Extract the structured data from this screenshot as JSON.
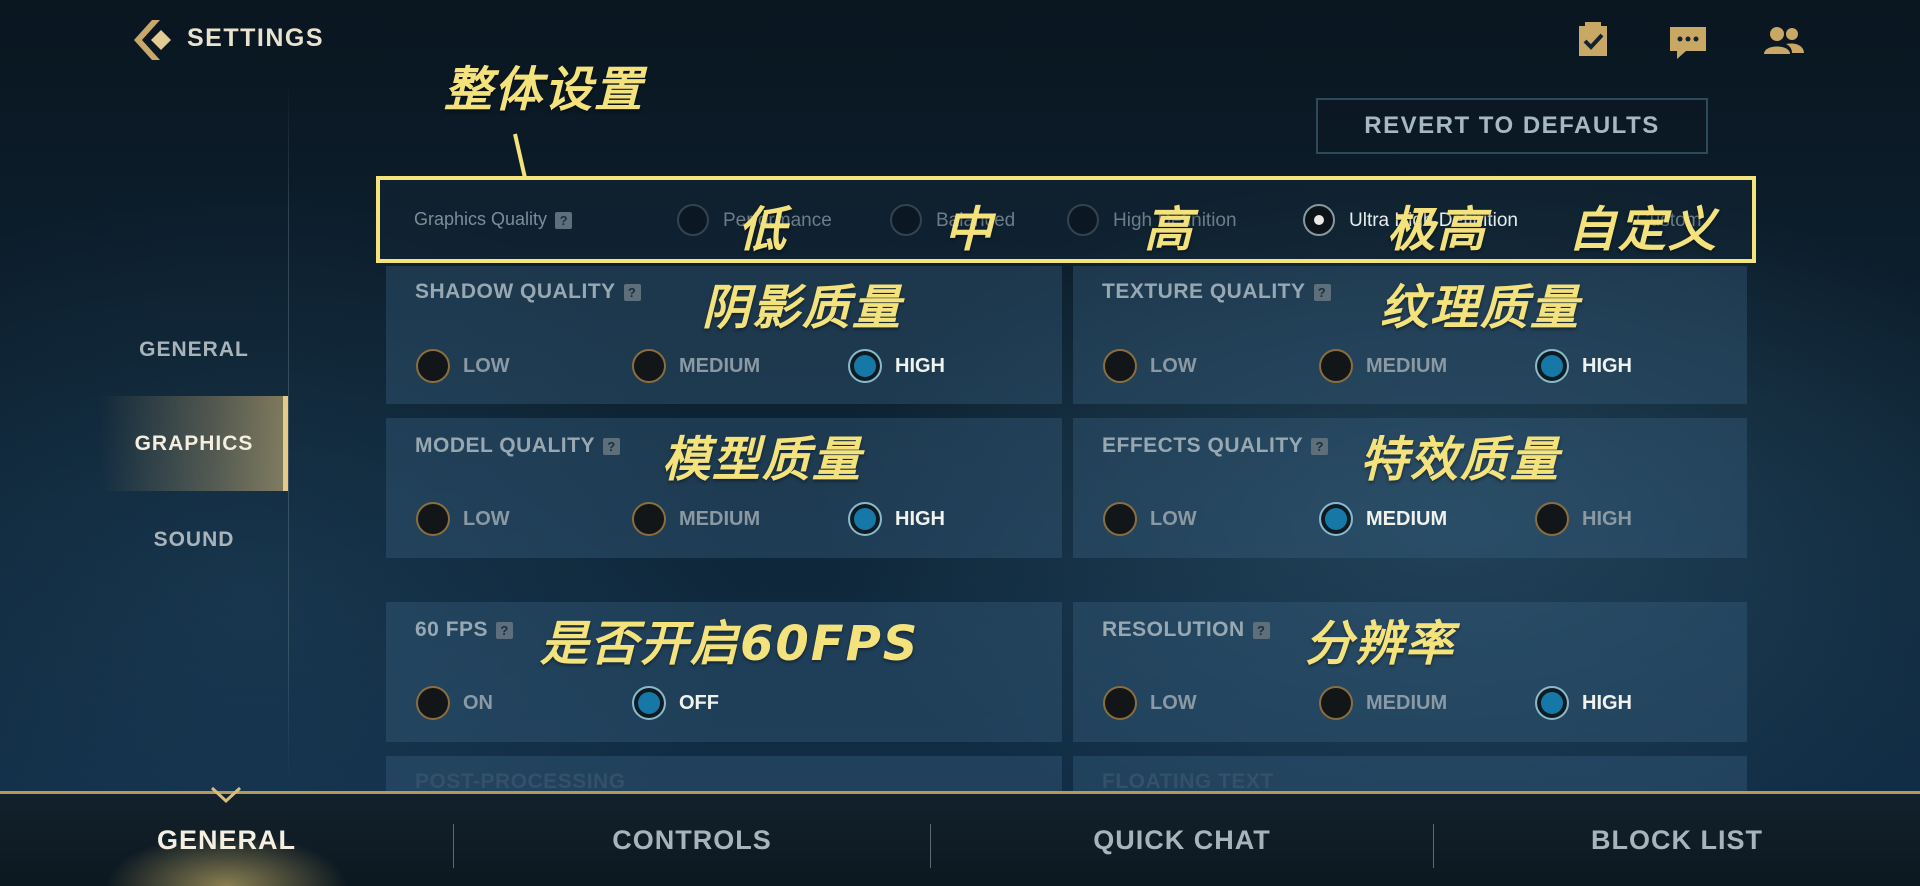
{
  "header": {
    "title": "SETTINGS",
    "back_icon": "chevron-left-logo-icon",
    "icons": [
      "checklist-icon",
      "chat-icon",
      "friends-icon"
    ]
  },
  "sidebar": {
    "items": [
      {
        "label": "GENERAL",
        "active": false
      },
      {
        "label": "GRAPHICS",
        "active": true
      },
      {
        "label": "SOUND",
        "active": false
      }
    ]
  },
  "revert_label": "REVERT TO DEFAULTS",
  "graphics_quality": {
    "label": "Graphics Quality",
    "help": "?",
    "options": [
      {
        "label": "Performance",
        "selected": false
      },
      {
        "label": "Balanced",
        "selected": false
      },
      {
        "label": "High Definition",
        "selected": false
      },
      {
        "label": "Ultra High Definition",
        "selected": true
      },
      {
        "label": "Custom",
        "selected": false
      }
    ]
  },
  "settings": {
    "shadow": {
      "title": "SHADOW QUALITY",
      "help": "?",
      "options": [
        "LOW",
        "MEDIUM",
        "HIGH"
      ],
      "selected": "HIGH"
    },
    "texture": {
      "title": "TEXTURE QUALITY",
      "help": "?",
      "options": [
        "LOW",
        "MEDIUM",
        "HIGH"
      ],
      "selected": "HIGH"
    },
    "model": {
      "title": "MODEL QUALITY",
      "help": "?",
      "options": [
        "LOW",
        "MEDIUM",
        "HIGH"
      ],
      "selected": "HIGH"
    },
    "effects": {
      "title": "EFFECTS QUALITY",
      "help": "?",
      "options": [
        "LOW",
        "MEDIUM",
        "HIGH"
      ],
      "selected": "MEDIUM"
    },
    "fps": {
      "title": "60 FPS",
      "help": "?",
      "options": [
        "ON",
        "OFF"
      ],
      "selected": "OFF"
    },
    "resolution": {
      "title": "RESOLUTION",
      "help": "?",
      "options": [
        "LOW",
        "MEDIUM",
        "HIGH"
      ],
      "selected": "HIGH"
    },
    "post_processing": {
      "title": "POST-PROCESSING"
    },
    "floating_text": {
      "title": "FLOATING TEXT"
    }
  },
  "annotations": {
    "overall": "整体设置",
    "low": "低",
    "mid": "中",
    "high": "高",
    "ultra": "极高",
    "custom": "自定义",
    "shadow": "阴影质量",
    "texture": "纹理质量",
    "model": "模型质量",
    "effects": "特效质量",
    "fps": "是否开启60FPS",
    "resolution": "分辨率"
  },
  "bottom_nav": {
    "items": [
      {
        "label": "GENERAL",
        "active": true
      },
      {
        "label": "CONTROLS",
        "active": false
      },
      {
        "label": "QUICK CHAT",
        "active": false
      },
      {
        "label": "BLOCK LIST",
        "active": false
      }
    ]
  },
  "colors": {
    "accent_gold": "#e7c98a",
    "annotation_yellow": "#f4e27d",
    "selected_blue": "#1578a6"
  }
}
